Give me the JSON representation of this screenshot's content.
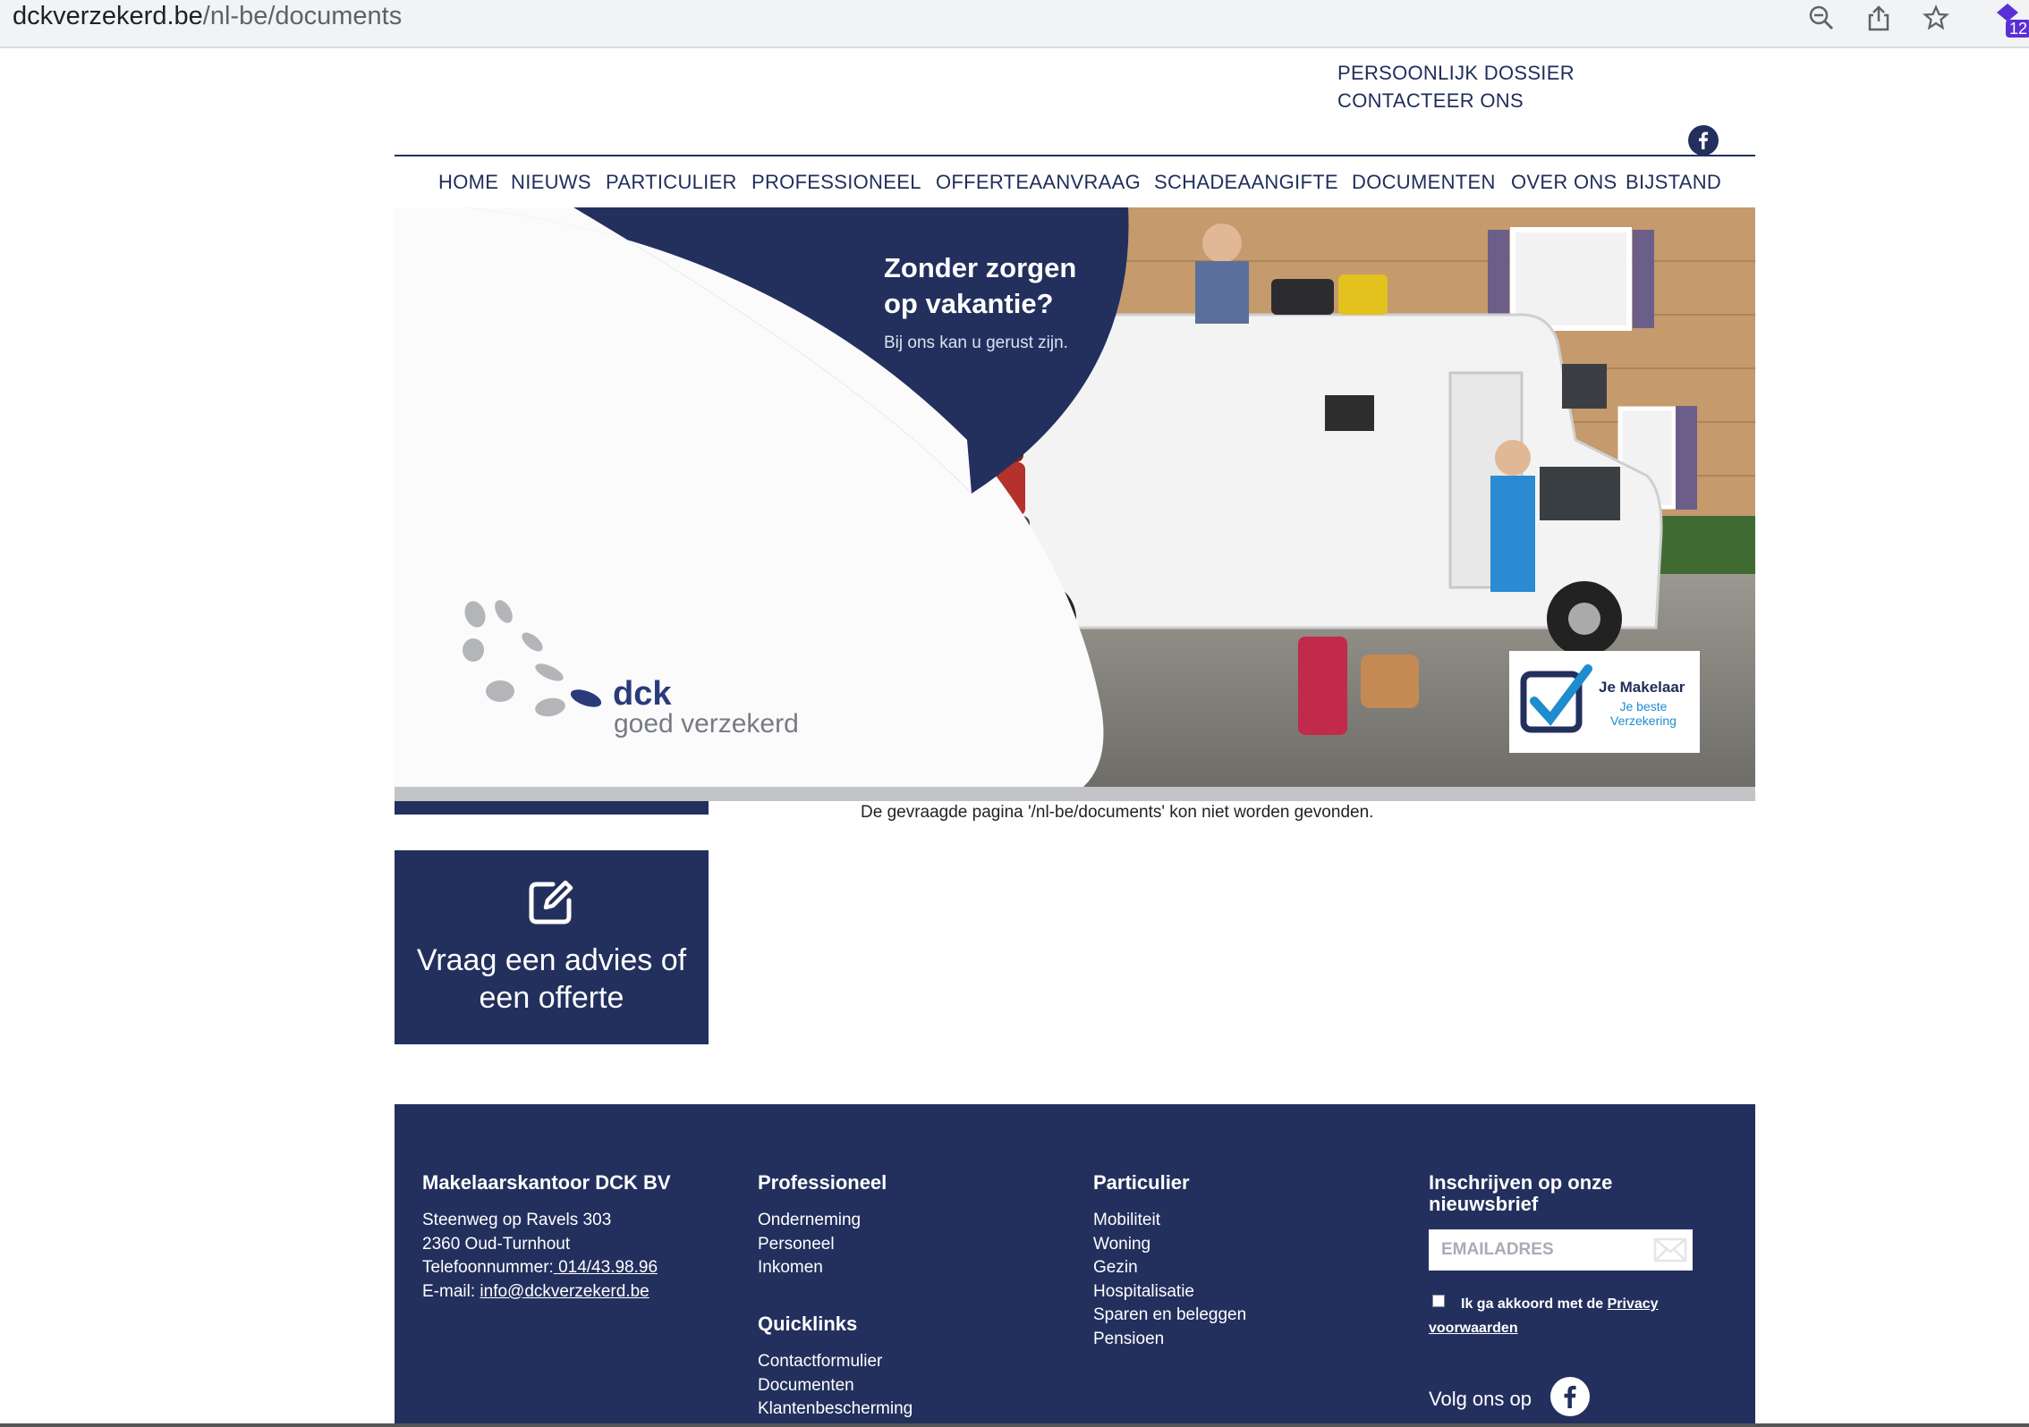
{
  "browser": {
    "url_domain": "dckverzekerd.be",
    "url_path": "/nl-be/documents",
    "extension_badge": "12",
    "icons": [
      "zoom-icon",
      "share-icon",
      "star-icon",
      "extension-icon"
    ]
  },
  "header": {
    "top_links": [
      "PERSOONLIJK DOSSIER",
      "CONTACTEER ONS"
    ],
    "social_icon": "facebook-icon"
  },
  "nav": {
    "items": [
      "HOME",
      "NIEUWS",
      "PARTICULIER",
      "PROFESSIONEEL",
      "OFFERTEAANVRAAG",
      "SCHADEAANGIFTE",
      "DOCUMENTEN",
      "OVER ONS",
      "BIJSTAND"
    ]
  },
  "hero": {
    "title_line1": "Zonder zorgen",
    "title_line2": "op vakantie?",
    "subtitle": "Bij ons kan u gerust zijn.",
    "logo_name": "dck",
    "logo_tagline": "goed verzekerd",
    "badge_title": "Je Makelaar",
    "badge_sub_line1": "Je beste",
    "badge_sub_line2": "Verzekering",
    "colors": {
      "navy": "#23305e",
      "brand_blue": "#2a3a7a",
      "badge_blue": "#1e8ccf"
    }
  },
  "content": {
    "error_message": "De gevraagde pagina '/nl-be/documents' kon niet worden gevonden.",
    "cta_label_line1": "Vraag een advies of",
    "cta_label_line2": "een offerte",
    "cta_icon": "edit-icon"
  },
  "footer": {
    "company": {
      "heading": "Makelaarskantoor DCK BV",
      "street": "Steenweg op Ravels 303",
      "city": "2360 Oud-Turnhout",
      "phone_label": "Telefoonnummer:",
      "phone": " 014/43.98.96",
      "email_label": "E-mail: ",
      "email": "info@dckverzekerd.be"
    },
    "professioneel": {
      "heading": "Professioneel",
      "links": [
        "Onderneming",
        "Personeel",
        "Inkomen"
      ]
    },
    "quicklinks": {
      "heading": "Quicklinks",
      "links": [
        "Contactformulier",
        "Documenten",
        "Klantenbescherming"
      ]
    },
    "particulier": {
      "heading": "Particulier",
      "links": [
        "Mobiliteit",
        "Woning",
        "Gezin",
        "Hospitalisatie",
        "Sparen en beleggen",
        "Pensioen"
      ]
    },
    "newsletter": {
      "heading_line1": "Inschrijven op onze",
      "heading_line2": "nieuwsbrief",
      "email_placeholder": "EMAILADRES",
      "consent_text": "Ik ga akkoord met de ",
      "consent_link": "Privacy voorwaarden",
      "follow_label": "Volg ons op"
    }
  }
}
